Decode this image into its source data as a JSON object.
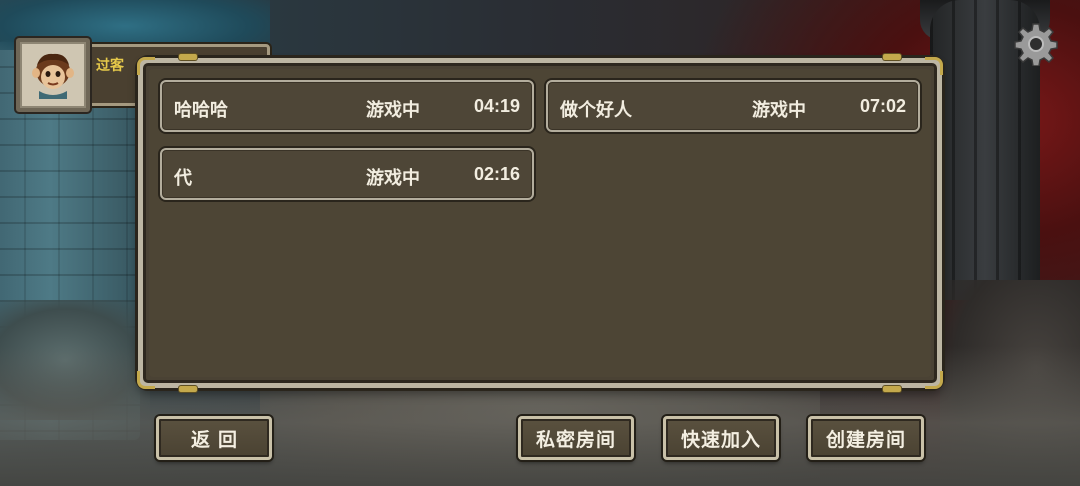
{
  "player": {
    "name": "过客"
  },
  "icons": {
    "avatar": "monkey-hero-avatar",
    "settings": "gear-icon"
  },
  "colors": {
    "accent_gold": "#e6c94a",
    "panel_bg": "#4a4234",
    "frame": "#bdb6a3",
    "text": "#f2ede0"
  },
  "rooms": [
    {
      "name": "哈哈哈",
      "status": "游戏中",
      "time": "04:19"
    },
    {
      "name": "做个好人",
      "status": "游戏中",
      "time": "07:02"
    },
    {
      "name": "代",
      "status": "游戏中",
      "time": "02:16"
    }
  ],
  "buttons": {
    "back": "返回",
    "private_room": "私密房间",
    "quick_join": "快速加入",
    "create_room": "创建房间"
  }
}
